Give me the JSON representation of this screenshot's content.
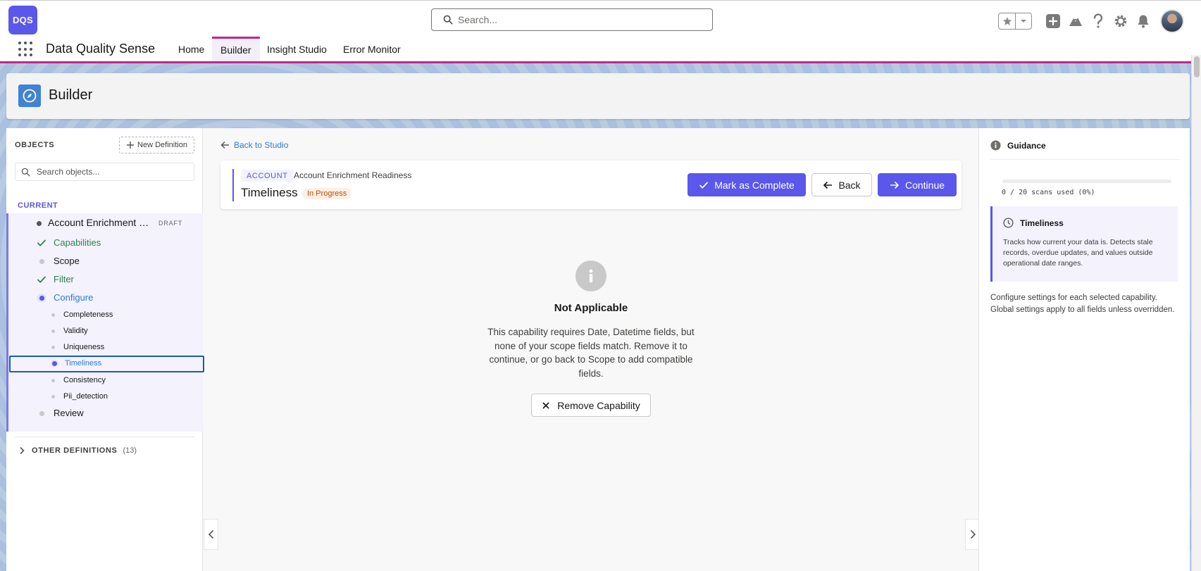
{
  "app": {
    "logo_text": "DQS",
    "name": "Data Quality Sense",
    "brand_color": "#5a57ea",
    "nav_accent": "#c1278f"
  },
  "search": {
    "placeholder": "Search..."
  },
  "nav": {
    "items": [
      {
        "label": "Home",
        "active": false
      },
      {
        "label": "Builder",
        "active": true
      },
      {
        "label": "Insight Studio",
        "active": false
      },
      {
        "label": "Error Monitor",
        "active": false
      }
    ]
  },
  "header_icons": [
    "star-icon",
    "chevron-down-icon",
    "plus-icon",
    "trailhead-icon",
    "help-icon",
    "gear-icon",
    "bell-icon",
    "avatar"
  ],
  "page": {
    "title": "Builder",
    "icon": "compass-icon"
  },
  "sidebar": {
    "objects_label": "OBJECTS",
    "new_definition_label": "New Definition",
    "search_placeholder": "Search objects...",
    "current_label": "CURRENT",
    "definition": {
      "name": "Account Enrichment Readiness",
      "badge": "DRAFT"
    },
    "steps": [
      {
        "label": "Capabilities",
        "state": "done"
      },
      {
        "label": "Scope",
        "state": "pending"
      },
      {
        "label": "Filter",
        "state": "done"
      },
      {
        "label": "Configure",
        "state": "active"
      }
    ],
    "substeps": [
      {
        "label": "Completeness",
        "selected": false
      },
      {
        "label": "Validity",
        "selected": false
      },
      {
        "label": "Uniqueness",
        "selected": false
      },
      {
        "label": "Timeliness",
        "selected": true
      },
      {
        "label": "Consistency",
        "selected": false
      },
      {
        "label": "Pii_detection",
        "selected": false
      }
    ],
    "review_label": "Review",
    "other_definitions_label": "OTHER DEFINITIONS",
    "other_definitions_count": "(13)"
  },
  "main": {
    "back_to_studio": "Back to Studio",
    "object_tag": "ACCOUNT",
    "definition_name": "Account Enrichment Readiness",
    "step_title": "Timeliness",
    "status": "In Progress",
    "mark_complete_label": "Mark as Complete",
    "back_label": "Back",
    "continue_label": "Continue",
    "empty_state": {
      "title": "Not Applicable",
      "message": "This capability requires Date, Datetime fields, but none of your scope fields match. Remove it to continue, or go back to Scope to add compatible fields.",
      "remove_label": "Remove Capability"
    }
  },
  "guidance": {
    "title": "Guidance",
    "scans_used": 0,
    "scans_total": 20,
    "scans_text": "0 / 20 scans used (0%)",
    "capability_title": "Timeliness",
    "capability_text": "Tracks how current your data is. Detects stale records, overdue updates, and values outside operational date ranges.",
    "note": "Configure settings for each selected capability. Global settings apply to all fields unless overridden."
  }
}
